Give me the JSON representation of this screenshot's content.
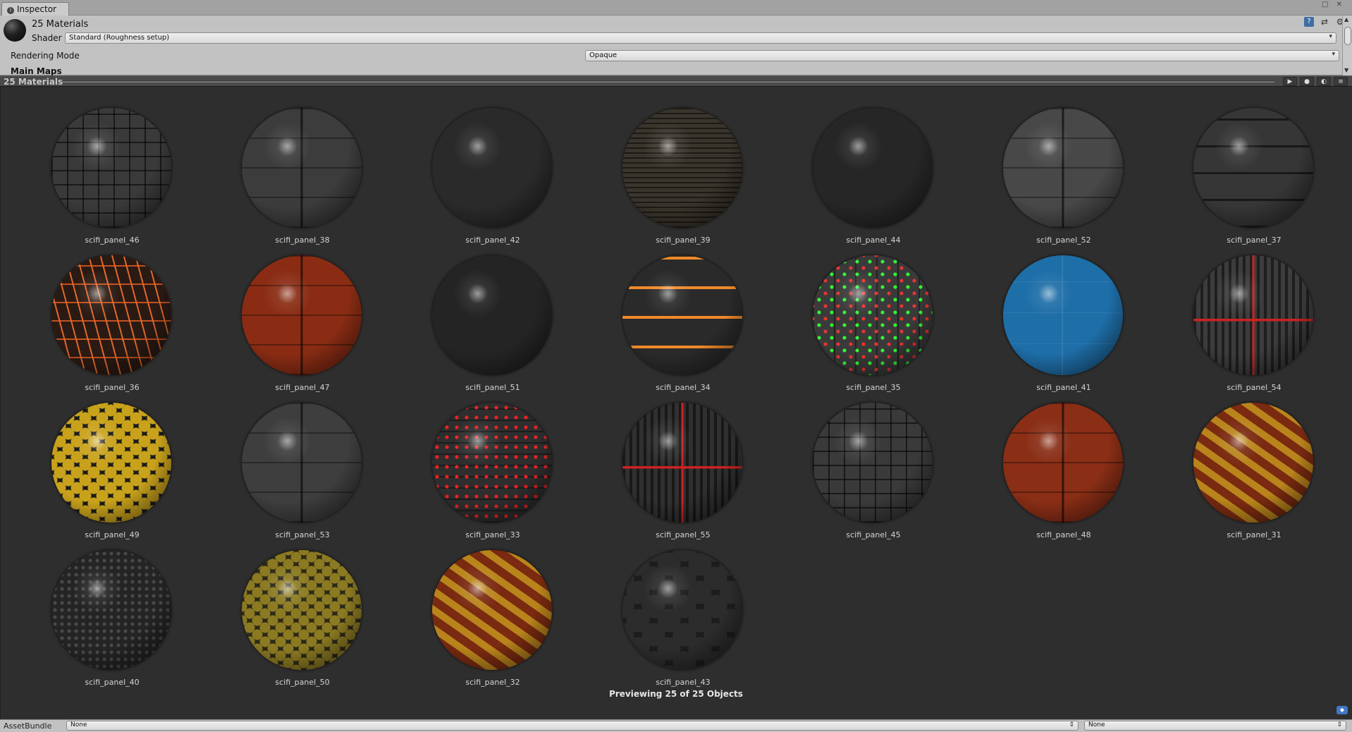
{
  "window": {
    "tab_title": "Inspector",
    "controls": "□ ✕"
  },
  "inspector": {
    "material_title": "25 Materials",
    "shader_label": "Shader",
    "shader_value": "Standard (Roughness setup)",
    "rendering_mode_label": "Rendering Mode",
    "rendering_mode_value": "Opaque",
    "main_maps_label": "Main Maps",
    "header_icons": [
      "book-icon",
      "sliders-icon",
      "gear-icon"
    ]
  },
  "preview": {
    "title": "25 Materials",
    "buttons": [
      {
        "name": "play-button",
        "glyph": "▶"
      },
      {
        "name": "sphere-button",
        "glyph": "●"
      },
      {
        "name": "lights-button",
        "glyph": "◐"
      },
      {
        "name": "menu-button",
        "glyph": "≡"
      }
    ],
    "status": "Previewing 25 of 25 Objects"
  },
  "materials": [
    {
      "name": "scifi_panel_46",
      "base": "#3a3a3a",
      "pattern": "grid"
    },
    {
      "name": "scifi_panel_38",
      "base": "#3c3c3c",
      "pattern": "panels"
    },
    {
      "name": "scifi_panel_42",
      "base": "#2a2a2a",
      "pattern": "plain"
    },
    {
      "name": "scifi_panel_39",
      "base": "#3a352c",
      "pattern": "hstripes-thin"
    },
    {
      "name": "scifi_panel_44",
      "base": "#262626",
      "pattern": "plain"
    },
    {
      "name": "scifi_panel_52",
      "base": "#484848",
      "pattern": "panels"
    },
    {
      "name": "scifi_panel_37",
      "base": "#363636",
      "pattern": "bands"
    },
    {
      "name": "scifi_panel_36",
      "base": "#2a1a14",
      "pattern": "circuit-orange"
    },
    {
      "name": "scifi_panel_47",
      "base": "#8a2c14",
      "pattern": "panels"
    },
    {
      "name": "scifi_panel_51",
      "base": "#242424",
      "pattern": "plain"
    },
    {
      "name": "scifi_panel_34",
      "base": "#2a2a2a",
      "pattern": "orange-rings"
    },
    {
      "name": "scifi_panel_35",
      "base": "#3a3a3a",
      "pattern": "lights-green-red"
    },
    {
      "name": "scifi_panel_41",
      "base": "#1e6ea8",
      "pattern": "panels-light"
    },
    {
      "name": "scifi_panel_54",
      "base": "#3c3c3c",
      "pattern": "red-cross"
    },
    {
      "name": "scifi_panel_49",
      "base": "#1a1a1a",
      "pattern": "hex-yellow"
    },
    {
      "name": "scifi_panel_53",
      "base": "#3e3e3e",
      "pattern": "panels"
    },
    {
      "name": "scifi_panel_33",
      "base": "#2e2e2e",
      "pattern": "lights-red"
    },
    {
      "name": "scifi_panel_55",
      "base": "#303030",
      "pattern": "red-cross"
    },
    {
      "name": "scifi_panel_45",
      "base": "#3a3a3a",
      "pattern": "grid"
    },
    {
      "name": "scifi_panel_48",
      "base": "#8a2e16",
      "pattern": "panels"
    },
    {
      "name": "scifi_panel_31",
      "base": "#7a2a10",
      "pattern": "diag-yellow"
    },
    {
      "name": "scifi_panel_40",
      "base": "#242424",
      "pattern": "dots"
    },
    {
      "name": "scifi_panel_50",
      "base": "#2a2818",
      "pattern": "hex-yellow-dim"
    },
    {
      "name": "scifi_panel_32",
      "base": "#7a2a10",
      "pattern": "diag-yellow"
    },
    {
      "name": "scifi_panel_43",
      "base": "#1c1c1c",
      "pattern": "hex-dark"
    }
  ],
  "bottom": {
    "assetbundle_label": "AssetBundle",
    "bundle_value": "None",
    "variant_value": "None"
  },
  "colors": {
    "accent": "#3f78c5",
    "preview_bg": "#2e2e2e",
    "inspector_bg": "#c2c2c2"
  }
}
